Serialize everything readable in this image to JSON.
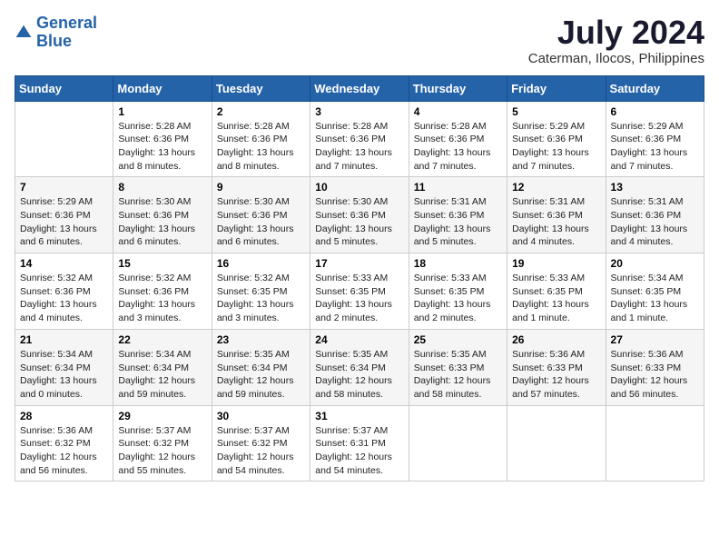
{
  "header": {
    "logo_line1": "General",
    "logo_line2": "Blue",
    "month_year": "July 2024",
    "location": "Caterman, Ilocos, Philippines"
  },
  "weekdays": [
    "Sunday",
    "Monday",
    "Tuesday",
    "Wednesday",
    "Thursday",
    "Friday",
    "Saturday"
  ],
  "weeks": [
    [
      {
        "day": "",
        "info": ""
      },
      {
        "day": "1",
        "info": "Sunrise: 5:28 AM\nSunset: 6:36 PM\nDaylight: 13 hours\nand 8 minutes."
      },
      {
        "day": "2",
        "info": "Sunrise: 5:28 AM\nSunset: 6:36 PM\nDaylight: 13 hours\nand 8 minutes."
      },
      {
        "day": "3",
        "info": "Sunrise: 5:28 AM\nSunset: 6:36 PM\nDaylight: 13 hours\nand 7 minutes."
      },
      {
        "day": "4",
        "info": "Sunrise: 5:28 AM\nSunset: 6:36 PM\nDaylight: 13 hours\nand 7 minutes."
      },
      {
        "day": "5",
        "info": "Sunrise: 5:29 AM\nSunset: 6:36 PM\nDaylight: 13 hours\nand 7 minutes."
      },
      {
        "day": "6",
        "info": "Sunrise: 5:29 AM\nSunset: 6:36 PM\nDaylight: 13 hours\nand 7 minutes."
      }
    ],
    [
      {
        "day": "7",
        "info": "Sunrise: 5:29 AM\nSunset: 6:36 PM\nDaylight: 13 hours\nand 6 minutes."
      },
      {
        "day": "8",
        "info": "Sunrise: 5:30 AM\nSunset: 6:36 PM\nDaylight: 13 hours\nand 6 minutes."
      },
      {
        "day": "9",
        "info": "Sunrise: 5:30 AM\nSunset: 6:36 PM\nDaylight: 13 hours\nand 6 minutes."
      },
      {
        "day": "10",
        "info": "Sunrise: 5:30 AM\nSunset: 6:36 PM\nDaylight: 13 hours\nand 5 minutes."
      },
      {
        "day": "11",
        "info": "Sunrise: 5:31 AM\nSunset: 6:36 PM\nDaylight: 13 hours\nand 5 minutes."
      },
      {
        "day": "12",
        "info": "Sunrise: 5:31 AM\nSunset: 6:36 PM\nDaylight: 13 hours\nand 4 minutes."
      },
      {
        "day": "13",
        "info": "Sunrise: 5:31 AM\nSunset: 6:36 PM\nDaylight: 13 hours\nand 4 minutes."
      }
    ],
    [
      {
        "day": "14",
        "info": "Sunrise: 5:32 AM\nSunset: 6:36 PM\nDaylight: 13 hours\nand 4 minutes."
      },
      {
        "day": "15",
        "info": "Sunrise: 5:32 AM\nSunset: 6:36 PM\nDaylight: 13 hours\nand 3 minutes."
      },
      {
        "day": "16",
        "info": "Sunrise: 5:32 AM\nSunset: 6:35 PM\nDaylight: 13 hours\nand 3 minutes."
      },
      {
        "day": "17",
        "info": "Sunrise: 5:33 AM\nSunset: 6:35 PM\nDaylight: 13 hours\nand 2 minutes."
      },
      {
        "day": "18",
        "info": "Sunrise: 5:33 AM\nSunset: 6:35 PM\nDaylight: 13 hours\nand 2 minutes."
      },
      {
        "day": "19",
        "info": "Sunrise: 5:33 AM\nSunset: 6:35 PM\nDaylight: 13 hours\nand 1 minute."
      },
      {
        "day": "20",
        "info": "Sunrise: 5:34 AM\nSunset: 6:35 PM\nDaylight: 13 hours\nand 1 minute."
      }
    ],
    [
      {
        "day": "21",
        "info": "Sunrise: 5:34 AM\nSunset: 6:34 PM\nDaylight: 13 hours\nand 0 minutes."
      },
      {
        "day": "22",
        "info": "Sunrise: 5:34 AM\nSunset: 6:34 PM\nDaylight: 12 hours\nand 59 minutes."
      },
      {
        "day": "23",
        "info": "Sunrise: 5:35 AM\nSunset: 6:34 PM\nDaylight: 12 hours\nand 59 minutes."
      },
      {
        "day": "24",
        "info": "Sunrise: 5:35 AM\nSunset: 6:34 PM\nDaylight: 12 hours\nand 58 minutes."
      },
      {
        "day": "25",
        "info": "Sunrise: 5:35 AM\nSunset: 6:33 PM\nDaylight: 12 hours\nand 58 minutes."
      },
      {
        "day": "26",
        "info": "Sunrise: 5:36 AM\nSunset: 6:33 PM\nDaylight: 12 hours\nand 57 minutes."
      },
      {
        "day": "27",
        "info": "Sunrise: 5:36 AM\nSunset: 6:33 PM\nDaylight: 12 hours\nand 56 minutes."
      }
    ],
    [
      {
        "day": "28",
        "info": "Sunrise: 5:36 AM\nSunset: 6:32 PM\nDaylight: 12 hours\nand 56 minutes."
      },
      {
        "day": "29",
        "info": "Sunrise: 5:37 AM\nSunset: 6:32 PM\nDaylight: 12 hours\nand 55 minutes."
      },
      {
        "day": "30",
        "info": "Sunrise: 5:37 AM\nSunset: 6:32 PM\nDaylight: 12 hours\nand 54 minutes."
      },
      {
        "day": "31",
        "info": "Sunrise: 5:37 AM\nSunset: 6:31 PM\nDaylight: 12 hours\nand 54 minutes."
      },
      {
        "day": "",
        "info": ""
      },
      {
        "day": "",
        "info": ""
      },
      {
        "day": "",
        "info": ""
      }
    ]
  ]
}
